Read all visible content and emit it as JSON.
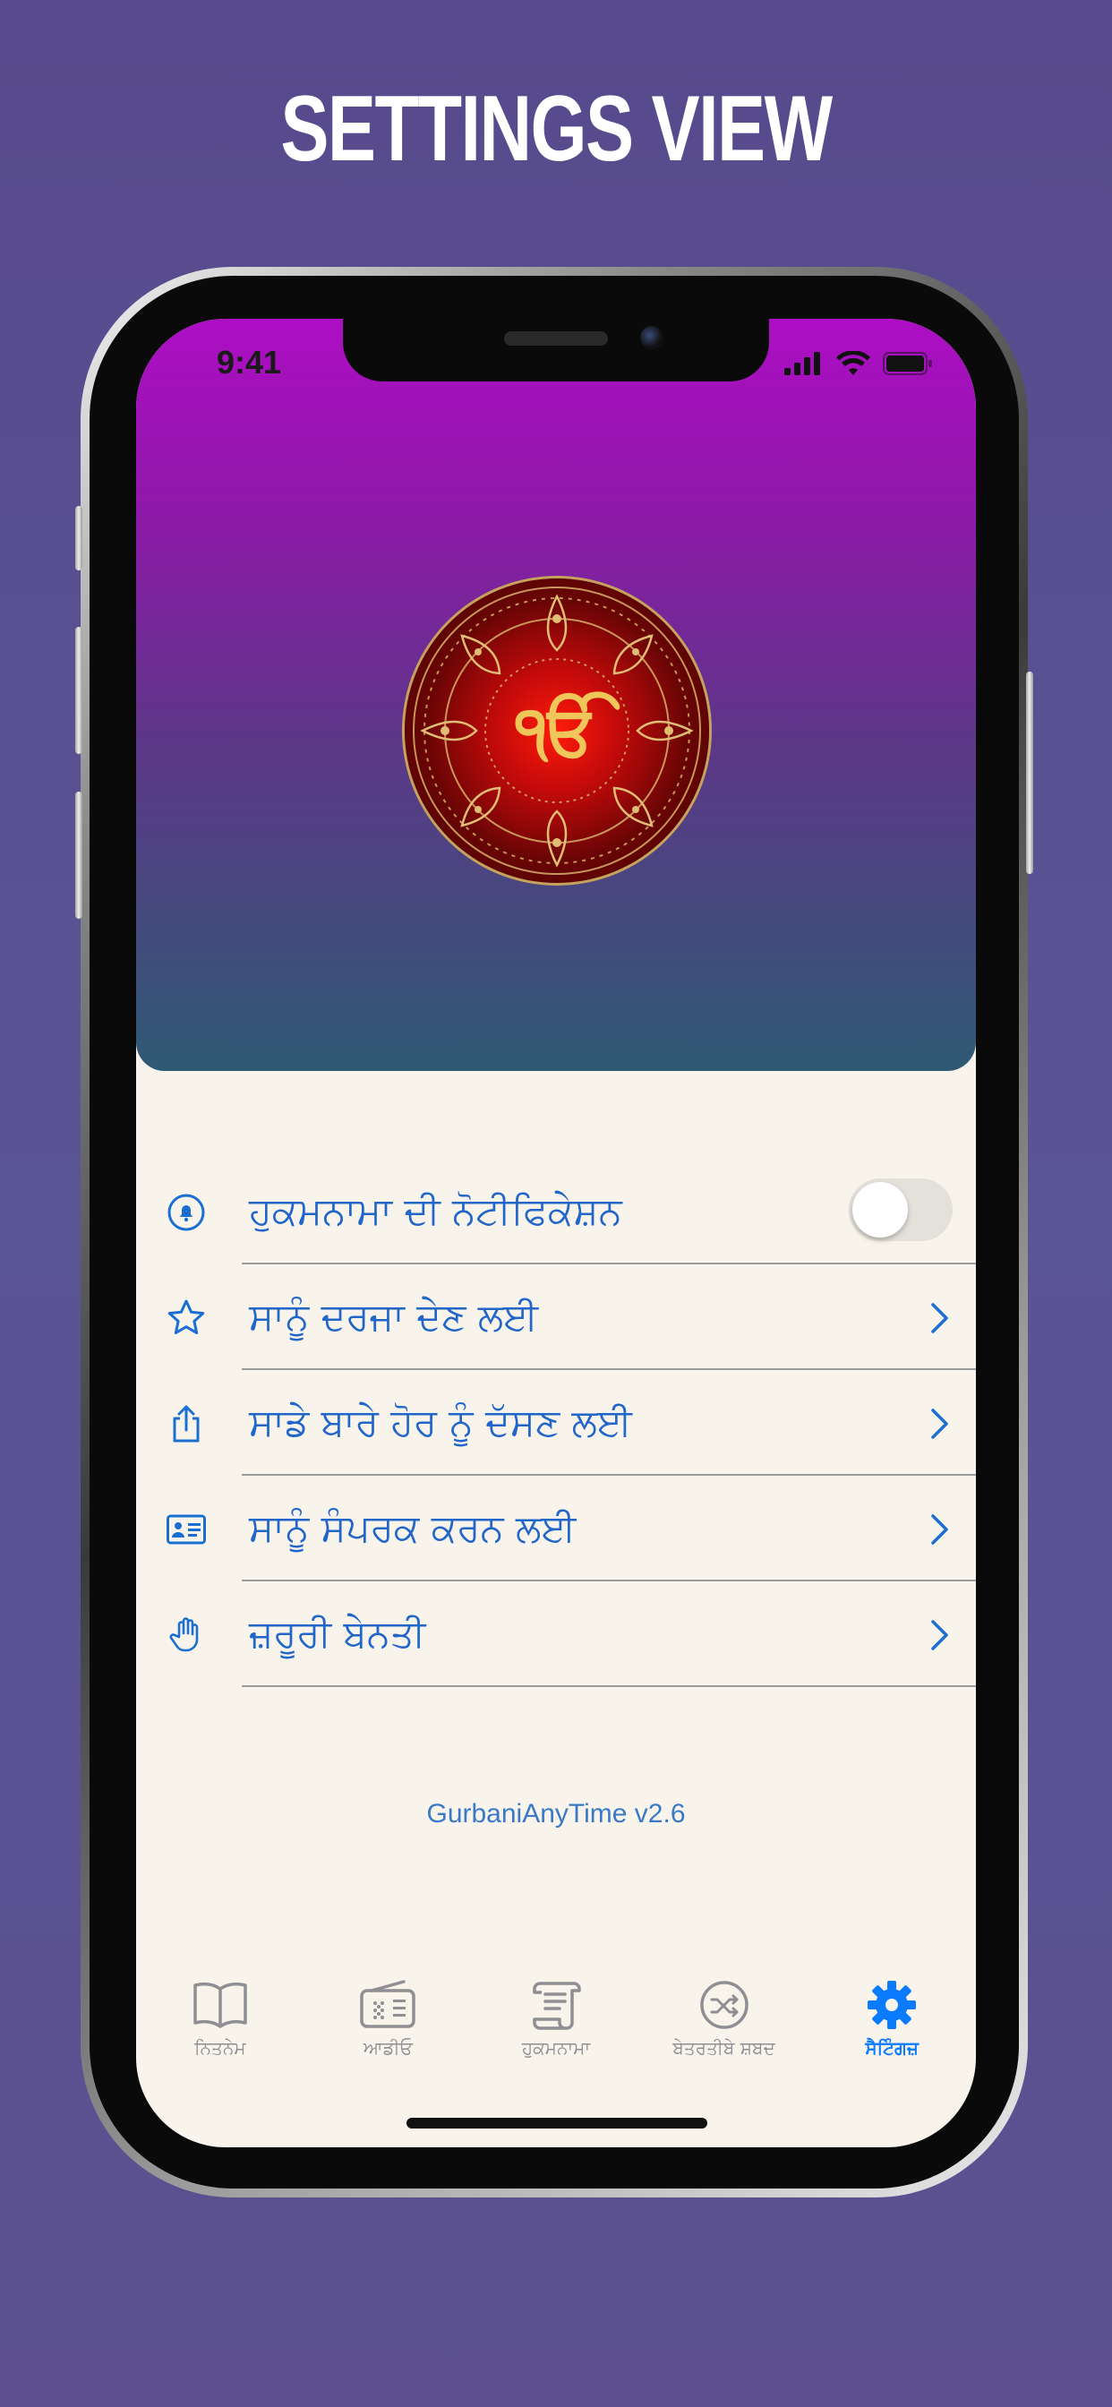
{
  "headline": "SETTINGS VIEW",
  "status_bar": {
    "time": "9:41",
    "icons": [
      "cellular-signal-icon",
      "wifi-icon",
      "battery-icon"
    ]
  },
  "header": {
    "logo": "ik-onkar-mandala-logo",
    "gradient_colors": [
      "#ad0ec4",
      "#5e3689",
      "#2f5a74"
    ]
  },
  "settings": {
    "items": [
      {
        "icon": "notification-bell-icon",
        "label": "ਹੁਕਮਨਾਮਾ ਦੀ ਨੋਟੀਫਿਕੇਸ਼ਨ",
        "control": "toggle",
        "toggle_on": false
      },
      {
        "icon": "star-icon",
        "label": "ਸਾਨੂੰ ਦਰਜਾ ਦੇਣ ਲਈ",
        "control": "chevron"
      },
      {
        "icon": "share-icon",
        "label": "ਸਾਡੇ ਬਾਰੇ ਹੋਰ ਨੂੰ ਦੱਸਣ ਲਈ",
        "control": "chevron"
      },
      {
        "icon": "contact-card-icon",
        "label": "ਸਾਨੂੰ ਸੰਪਰਕ ਕਰਨ ਲਈ",
        "control": "chevron"
      },
      {
        "icon": "hand-raised-icon",
        "label": "ਜ਼ਰੂਰੀ ਬੇਨਤੀ",
        "control": "chevron"
      }
    ]
  },
  "version": "GurbaniAnyTime v2.6",
  "tabbar": {
    "tabs": [
      {
        "icon": "book-icon",
        "label": "ਨਿਤਨੇਮ",
        "active": false
      },
      {
        "icon": "radio-icon",
        "label": "ਆਡੀਓ",
        "active": false
      },
      {
        "icon": "scroll-icon",
        "label": "ਹੁਕਮਨਾਮਾ",
        "active": false
      },
      {
        "icon": "shuffle-icon",
        "label": "ਬੇਤਰਤੀਬੇ ਸ਼ਬਦ",
        "active": false
      },
      {
        "icon": "gear-icon",
        "label": "ਸੈਟਿੰਗਜ਼",
        "active": true
      }
    ]
  },
  "colors": {
    "accent": "#0a7aff",
    "label_blue": "#2166c8",
    "background": "#f8f4eb",
    "page_background": "#574a8c"
  }
}
